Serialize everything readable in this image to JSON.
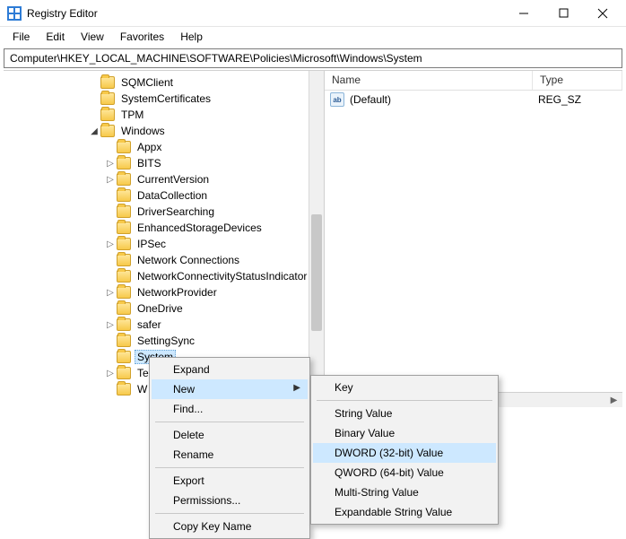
{
  "window": {
    "title": "Registry Editor"
  },
  "menubar": [
    "File",
    "Edit",
    "View",
    "Favorites",
    "Help"
  ],
  "address": "Computer\\HKEY_LOCAL_MACHINE\\SOFTWARE\\Policies\\Microsoft\\Windows\\System",
  "tree": [
    {
      "indent": 94,
      "twist": "",
      "label": "SQMClient"
    },
    {
      "indent": 94,
      "twist": "",
      "label": "SystemCertificates"
    },
    {
      "indent": 94,
      "twist": "",
      "label": "TPM"
    },
    {
      "indent": 94,
      "twist": "v",
      "label": "Windows"
    },
    {
      "indent": 112,
      "twist": "",
      "label": "Appx"
    },
    {
      "indent": 112,
      "twist": ">",
      "label": "BITS"
    },
    {
      "indent": 112,
      "twist": ">",
      "label": "CurrentVersion"
    },
    {
      "indent": 112,
      "twist": "",
      "label": "DataCollection"
    },
    {
      "indent": 112,
      "twist": "",
      "label": "DriverSearching"
    },
    {
      "indent": 112,
      "twist": "",
      "label": "EnhancedStorageDevices"
    },
    {
      "indent": 112,
      "twist": ">",
      "label": "IPSec"
    },
    {
      "indent": 112,
      "twist": "",
      "label": "Network Connections"
    },
    {
      "indent": 112,
      "twist": "",
      "label": "NetworkConnectivityStatusIndicator"
    },
    {
      "indent": 112,
      "twist": ">",
      "label": "NetworkProvider"
    },
    {
      "indent": 112,
      "twist": "",
      "label": "OneDrive"
    },
    {
      "indent": 112,
      "twist": ">",
      "label": "safer"
    },
    {
      "indent": 112,
      "twist": "",
      "label": "SettingSync"
    },
    {
      "indent": 112,
      "twist": "",
      "label": "System",
      "selected": true
    },
    {
      "indent": 112,
      "twist": ">",
      "label": "Te"
    },
    {
      "indent": 112,
      "twist": "",
      "label": "W"
    }
  ],
  "list": {
    "headers": {
      "name": "Name",
      "type": "Type"
    },
    "rows": [
      {
        "icon": "ab",
        "name": "(Default)",
        "type": "REG_SZ"
      }
    ]
  },
  "ctx1": {
    "items": [
      {
        "label": "Expand"
      },
      {
        "label": "New",
        "submenu": true,
        "hov": true
      },
      {
        "label": "Find..."
      },
      {
        "sep": true
      },
      {
        "label": "Delete"
      },
      {
        "label": "Rename"
      },
      {
        "sep": true
      },
      {
        "label": "Export"
      },
      {
        "label": "Permissions..."
      },
      {
        "sep": true
      },
      {
        "label": "Copy Key Name"
      }
    ]
  },
  "ctx2": {
    "items": [
      {
        "label": "Key"
      },
      {
        "sep": true
      },
      {
        "label": "String Value"
      },
      {
        "label": "Binary Value"
      },
      {
        "label": "DWORD (32-bit) Value",
        "hov": true
      },
      {
        "label": "QWORD (64-bit) Value"
      },
      {
        "label": "Multi-String Value"
      },
      {
        "label": "Expandable String Value"
      }
    ]
  }
}
